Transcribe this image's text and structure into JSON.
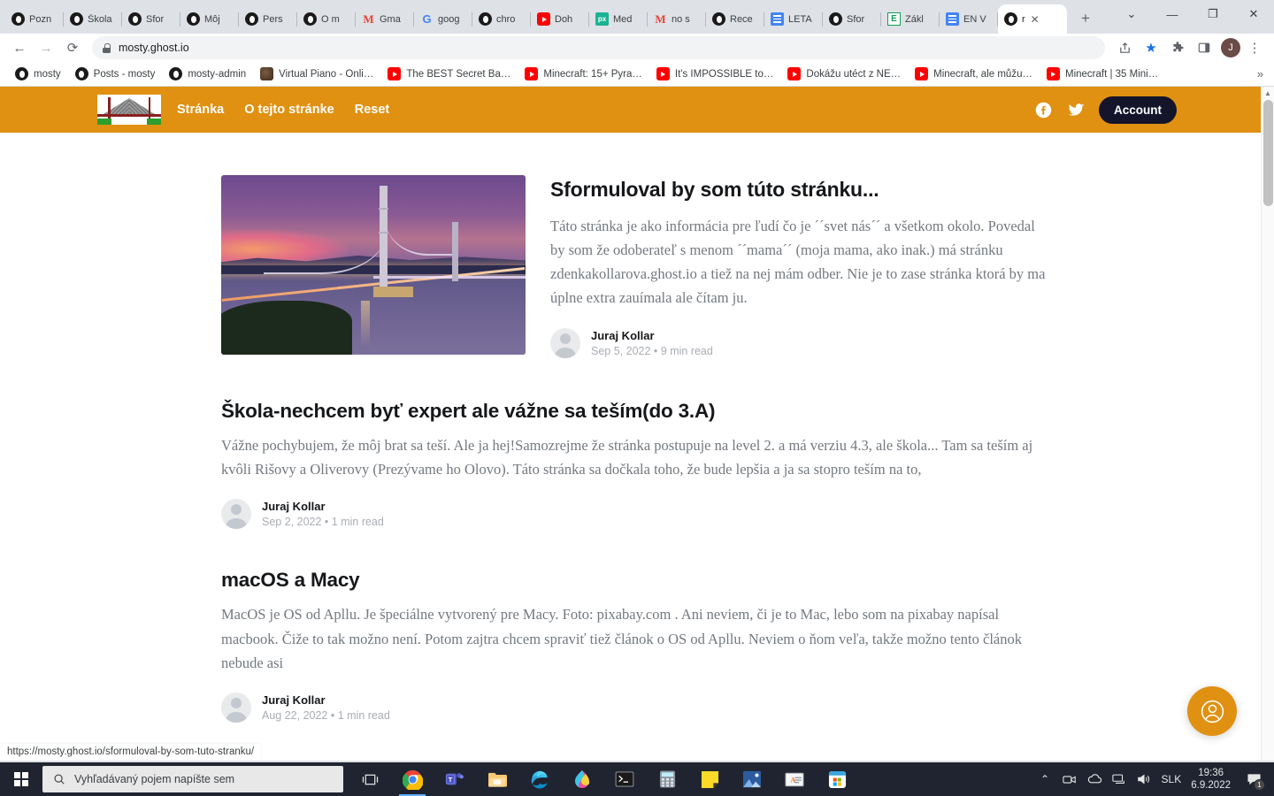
{
  "browser": {
    "tabs": [
      {
        "label": "Pozn",
        "icon": "ghost-favicon"
      },
      {
        "label": "Škola",
        "icon": "ghost-favicon"
      },
      {
        "label": "Sfor",
        "icon": "ghost-favicon"
      },
      {
        "label": "Môj",
        "icon": "ghost-favicon"
      },
      {
        "label": "Pers",
        "icon": "ghost-favicon"
      },
      {
        "label": "O m",
        "icon": "ghost-favicon"
      },
      {
        "label": "Gma",
        "icon": "gmail-icon"
      },
      {
        "label": "goog",
        "icon": "google-icon"
      },
      {
        "label": "chro",
        "icon": "ghost-favicon"
      },
      {
        "label": "Doh",
        "icon": "youtube-icon"
      },
      {
        "label": "Med",
        "icon": "pixabay-icon"
      },
      {
        "label": "no s",
        "icon": "gmail-icon"
      },
      {
        "label": "Rece",
        "icon": "ghost-favicon"
      },
      {
        "label": "LETA",
        "icon": "google-docs-icon"
      },
      {
        "label": "Sfor",
        "icon": "ghost-favicon"
      },
      {
        "label": "Zákl",
        "icon": "google-sheets-icon"
      },
      {
        "label": "EN V",
        "icon": "google-docs-icon"
      },
      {
        "label": "r",
        "icon": "ghost-favicon",
        "active": true,
        "close": "✕"
      }
    ],
    "new_tab_label": "+",
    "window_controls": {
      "tab_search": "⌄",
      "minimize": "—",
      "maximize": "❐",
      "close": "✕"
    },
    "toolbar": {
      "back": "←",
      "forward": "→",
      "reload": "⟳",
      "url": "mosty.ghost.io",
      "share_icon": "share-icon",
      "bookmark_icon": "star-icon",
      "extensions_icon": "puzzle-icon",
      "sidepanel_icon": "side-panel-icon",
      "profile_initial": "J",
      "menu": "⋮"
    },
    "bookmarks": [
      {
        "label": "mosty",
        "icon": "ghost-favicon"
      },
      {
        "label": "Posts - mosty",
        "icon": "ghost-favicon"
      },
      {
        "label": "mosty-admin",
        "icon": "ghost-favicon"
      },
      {
        "label": "Virtual Piano - Onli…",
        "icon": "piano-icon"
      },
      {
        "label": "The BEST Secret Ba…",
        "icon": "youtube-icon"
      },
      {
        "label": "Minecraft: 15+ Pyra…",
        "icon": "youtube-icon"
      },
      {
        "label": "It's IMPOSSIBLE to…",
        "icon": "youtube-icon"
      },
      {
        "label": "Dokážu utéct z NE…",
        "icon": "youtube-icon"
      },
      {
        "label": "Minecraft, ale můžu…",
        "icon": "youtube-icon"
      },
      {
        "label": "Minecraft | 35 Mini…",
        "icon": "youtube-icon"
      }
    ],
    "bookmarks_overflow": "»",
    "status_bar_url": "https://mosty.ghost.io/sformuloval-by-som-tuto-stranku/"
  },
  "site": {
    "accent_color": "#e09112",
    "nav": {
      "logo_name": "bridge-logo",
      "links": [
        "Stránka",
        "O tejto stránke",
        "Reset"
      ],
      "facebook_icon": "facebook-icon",
      "twitter_icon": "twitter-icon",
      "account_button": "Account"
    },
    "posts": [
      {
        "title": "Sformuloval by som túto stránku...",
        "excerpt": "Táto stránka je ako informácia pre ľudí čo je ´´svet nás´´ a všetkom okolo. Povedal by som že odoberateľ s menom ´´mama´´ (moja mama, ako inak.) má stránku zdenkakollarova.ghost.io a tiež na nej mám odber. Nie je to zase stránka ktorá by ma úplne extra zauímala ale čítam ju.",
        "author": "Juraj Kollar",
        "date": "Sep 5, 2022",
        "separator": "•",
        "read_time": "9 min read",
        "featured_image": "suspension-bridge-at-dusk"
      },
      {
        "title": "Škola-nechcem byť expert ale vážne sa teším(do 3.A)",
        "excerpt": "Vážne pochybujem, že môj brat sa teší. Ale ja hej!Samozrejme že stránka postupuje na level 2. a má verziu 4.3, ale škola... Tam sa teším aj kvôli Rišovy a Oliverovy (Prezývame ho Olovo). Táto stránka sa dočkala toho, že bude lepšia a ja sa stopro teším na to,",
        "author": "Juraj Kollar",
        "date": "Sep 2, 2022",
        "separator": "•",
        "read_time": "1 min read"
      },
      {
        "title": "macOS a Macy",
        "excerpt": "MacOS je OS od Apllu. Je špeciálne vytvorený pre Macy. Foto: pixabay.com . Ani neviem, či je to Mac, lebo som na pixabay napísal macbook. Čiže to tak možno není. Potom zajtra chcem spraviť tiež článok o OS od Apllu. Neviem o ňom veľa, takže možno tento článok nebude asi",
        "author": "Juraj Kollar",
        "date": "Aug 22, 2022",
        "separator": "•",
        "read_time": "1 min read"
      }
    ],
    "fab_icon": "account-circle-icon"
  },
  "taskbar": {
    "start_icon": "windows-start-icon",
    "search_placeholder": "Vyhľadávaný pojem napíšte sem",
    "search_icon": "search-icon",
    "task_view_icon": "task-view-icon",
    "apps": [
      {
        "name": "chrome-icon",
        "active": true
      },
      {
        "name": "teams-icon"
      },
      {
        "name": "file-explorer-icon"
      },
      {
        "name": "edge-icon"
      },
      {
        "name": "paint3d-icon"
      },
      {
        "name": "command-prompt-icon"
      },
      {
        "name": "calculator-icon"
      },
      {
        "name": "sticky-notes-icon"
      },
      {
        "name": "photos-icon"
      },
      {
        "name": "dictionary-icon"
      },
      {
        "name": "microsoft-store-icon"
      }
    ],
    "tray": {
      "chevron": "⌃",
      "icons": [
        "meet-now-icon",
        "onedrive-icon",
        "network-icon",
        "volume-icon"
      ],
      "language": "SLK",
      "time": "19:36",
      "date": "6.9.2022",
      "notification_count": "1"
    }
  }
}
